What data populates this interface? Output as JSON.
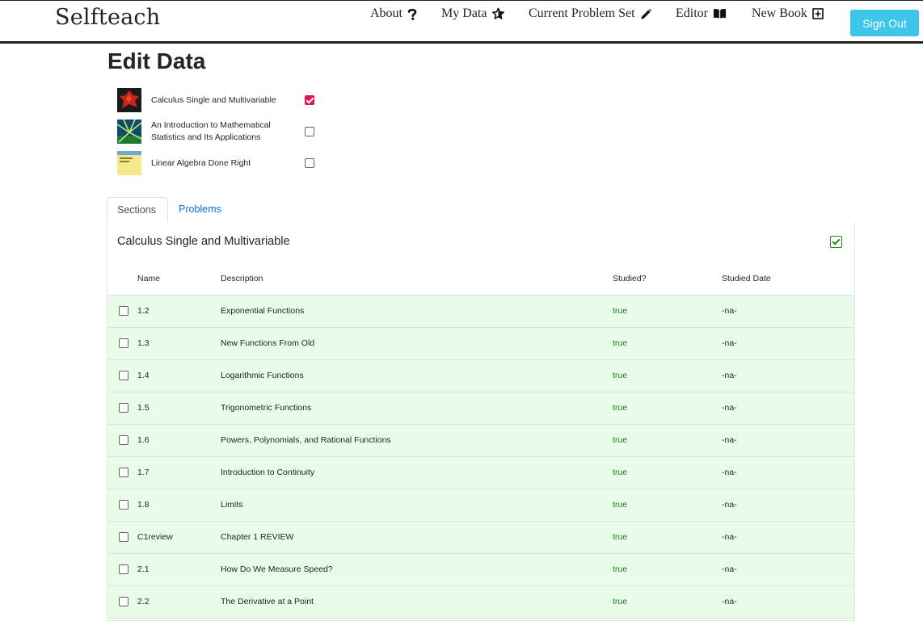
{
  "nav": {
    "brand": "Selfteach",
    "items": [
      {
        "label": "About",
        "icon": "question-icon"
      },
      {
        "label": "My Data",
        "icon": "star-icon"
      },
      {
        "label": "Current Problem Set",
        "icon": "pencil-icon"
      },
      {
        "label": "Editor",
        "icon": "book-icon"
      },
      {
        "label": "New Book",
        "icon": "plus-square-icon"
      }
    ],
    "sign_out": "Sign Out"
  },
  "page_title": "Edit Data",
  "books": [
    {
      "title": "Calculus Single and Multivariable",
      "checked": true
    },
    {
      "title": "An Introduction to Mathematical Statistics and Its Applications",
      "checked": false
    },
    {
      "title": "Linear Algebra Done Right",
      "checked": false
    }
  ],
  "tabs": {
    "sections": "Sections",
    "problems": "Problems"
  },
  "card": {
    "title": "Calculus Single and Multivariable",
    "columns": {
      "name": "Name",
      "description": "Description",
      "studied": "Studied?",
      "date": "Studied Date"
    },
    "rows": [
      {
        "name": "1.2",
        "description": "Exponential Functions",
        "studied": "true",
        "date": "-na-"
      },
      {
        "name": "1.3",
        "description": "New Functions From Old",
        "studied": "true",
        "date": "-na-"
      },
      {
        "name": "1.4",
        "description": "Logarithmic Functions",
        "studied": "true",
        "date": "-na-"
      },
      {
        "name": "1.5",
        "description": "Trigonometric Functions",
        "studied": "true",
        "date": "-na-"
      },
      {
        "name": "1.6",
        "description": "Powers, Polynomials, and Rational Functions",
        "studied": "true",
        "date": "-na-"
      },
      {
        "name": "1.7",
        "description": "Introduction to Continuity",
        "studied": "true",
        "date": "-na-"
      },
      {
        "name": "1.8",
        "description": "Limits",
        "studied": "true",
        "date": "-na-"
      },
      {
        "name": "C1review",
        "description": "Chapter 1 REVIEW",
        "studied": "true",
        "date": "-na-"
      },
      {
        "name": "2.1",
        "description": "How Do We Measure Speed?",
        "studied": "true",
        "date": "-na-"
      },
      {
        "name": "2.2",
        "description": "The Derivative at a Point",
        "studied": "true",
        "date": "-na-"
      }
    ]
  },
  "colors": {
    "accent": "#3ec6ea",
    "check_red": "#e0174b",
    "row_green": "#e9fbe9",
    "true_green": "#1e7a1e",
    "link": "#0b6ee0"
  }
}
